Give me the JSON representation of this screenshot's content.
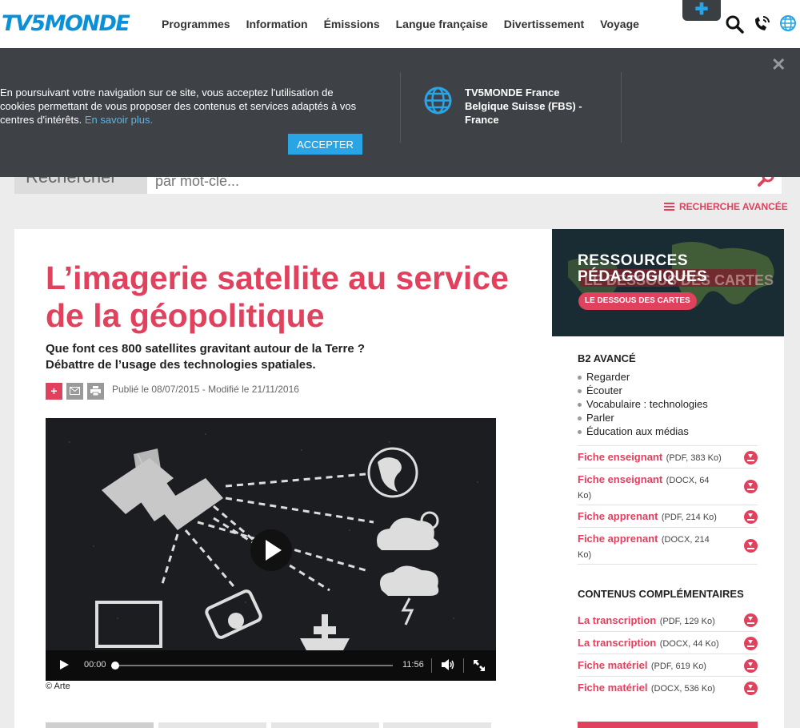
{
  "header": {
    "logo": "TV5MONDE",
    "nav": [
      "Programmes",
      "Information",
      "Émissions",
      "Langue française",
      "Divertissement",
      "Voyage"
    ],
    "plus_icon": "plus-icon",
    "icons": [
      "search-icon",
      "broadcast-icon",
      "globe-icon"
    ]
  },
  "cookie": {
    "text": "En poursuivant votre navigation sur ce site, vous acceptez l'utilisation de cookies permettant de vous proposer des contenus et services adaptés à vos centres d'intérêts.",
    "more_link": "En savoir plus.",
    "accept": "ACCEPTER",
    "region": "TV5MONDE France Belgique Suisse (FBS) - France"
  },
  "search": {
    "label": "Rechercher",
    "placeholder": "par mot-clé...",
    "advanced": "RECHERCHE AVANCÉE"
  },
  "article": {
    "title": "L’imagerie satellite au service de la géopolitique",
    "subtitle_line1": "Que font ces 800 satellites gravitant autour de la Terre ?",
    "subtitle_line2": "Débattre de l’usage des technologies spatiales.",
    "published": "Publié le 08/07/2015 - Modifié le 21/11/2016",
    "credit": "© Arte"
  },
  "video": {
    "current_time": "00:00",
    "duration": "11:56",
    "progress": 0
  },
  "sidebar": {
    "promo_title_1": "RESSOURCES",
    "promo_title_2": "PÉDAGOGIQUES",
    "promo_badge": "LE DESSOUS DES CARTES",
    "promo_bg_text": "LE DESSOUS DES CARTES",
    "level": "B2 AVANCÉ",
    "skills": [
      "Regarder",
      "Écouter",
      "Vocabulaire : technologies",
      "Parler",
      "Éducation aux médias"
    ],
    "downloads": [
      {
        "name": "Fiche enseignant",
        "meta": "(PDF, 383 Ko)"
      },
      {
        "name": "Fiche enseignant",
        "meta": "(DOCX, 64 Ko)"
      },
      {
        "name": "Fiche apprenant",
        "meta": "(PDF, 214 Ko)"
      },
      {
        "name": "Fiche apprenant",
        "meta": "(DOCX, 214 Ko)"
      }
    ],
    "extra_heading": "CONTENUS COMPLÉMENTAIRES",
    "extras": [
      {
        "name": "La transcription",
        "meta": "(PDF, 129 Ko)"
      },
      {
        "name": "La transcription",
        "meta": "(DOCX, 44 Ko)"
      },
      {
        "name": "Fiche matériel",
        "meta": "(PDF, 619 Ko)"
      },
      {
        "name": "Fiche matériel",
        "meta": "(DOCX, 536 Ko)"
      }
    ]
  },
  "colors": {
    "brand_blue": "#0a90d6",
    "accent_pink": "#e0415d",
    "banner_bg": "#3e4246"
  }
}
